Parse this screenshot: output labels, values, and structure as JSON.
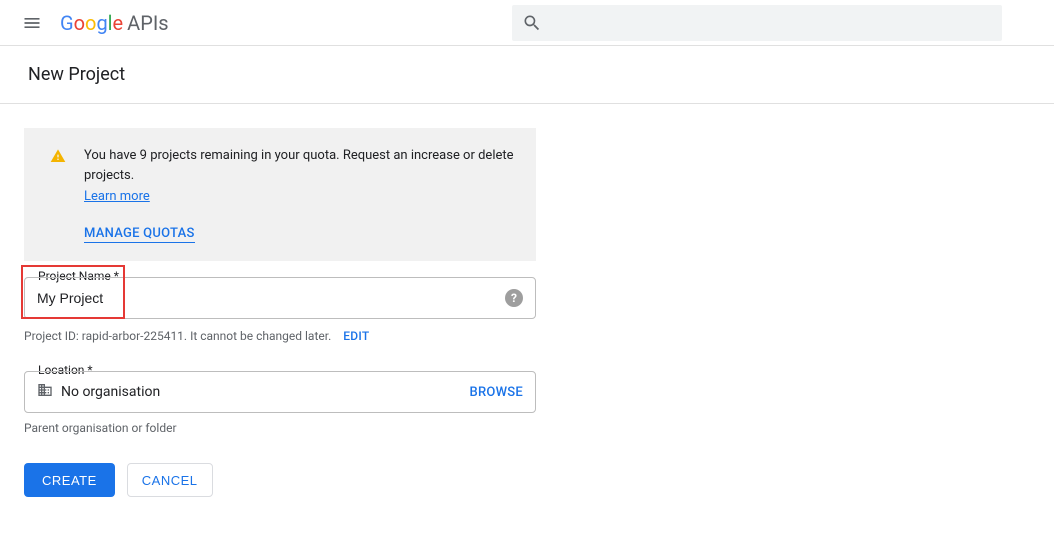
{
  "header": {
    "brand_suffix": "APIs",
    "search_placeholder": ""
  },
  "page_title": "New Project",
  "quota_notice": {
    "text": "You have 9 projects remaining in your quota. Request an increase or delete projects.",
    "learn_more_label": "Learn more",
    "manage_quotas_label": "MANAGE QUOTAS"
  },
  "project_name_field": {
    "label": "Project Name",
    "required_marker": "*",
    "value": "My Project"
  },
  "project_id_line": {
    "text": "Project ID: rapid-arbor-225411. It cannot be changed later.",
    "edit_label": "EDIT"
  },
  "location_field": {
    "label": "Location",
    "required_marker": "*",
    "value": "No organisation",
    "browse_label": "BROWSE",
    "helper": "Parent organisation or folder"
  },
  "actions": {
    "create_label": "CREATE",
    "cancel_label": "CANCEL"
  }
}
